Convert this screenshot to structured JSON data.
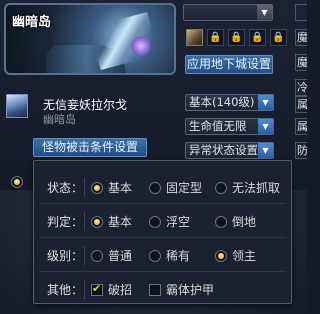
{
  "dungeon": {
    "title": "幽暗岛"
  },
  "top_dropdown": {
    "value": ""
  },
  "slots": {
    "lock_glyph": "🔒"
  },
  "apply_button": {
    "label": "应用地下城设置"
  },
  "boss": {
    "name": "无信妾妖拉尔戈",
    "location": "幽暗岛"
  },
  "selects": {
    "level": "基本(140级)",
    "hp": "生命值无限",
    "status": "异常状态设置"
  },
  "hit_condition_button": {
    "label": "怪物被击条件设置"
  },
  "right_edge_chars": [
    "魔",
    "魔",
    "冷",
    "属",
    "属",
    "防"
  ],
  "left_radio_partial": "",
  "panel": {
    "rows": [
      {
        "label": "状态：",
        "options": [
          {
            "text": "基本",
            "checked": true
          },
          {
            "text": "固定型",
            "checked": false
          },
          {
            "text": "无法抓取",
            "checked": false
          }
        ]
      },
      {
        "label": "判定：",
        "options": [
          {
            "text": "基本",
            "checked": true
          },
          {
            "text": "浮空",
            "checked": false
          },
          {
            "text": "倒地",
            "checked": false
          }
        ]
      },
      {
        "label": "级别：",
        "options": [
          {
            "text": "普通",
            "checked": false
          },
          {
            "text": "稀有",
            "checked": false
          },
          {
            "text": "领主",
            "checked": true
          }
        ]
      },
      {
        "label": "其他：",
        "options": [
          {
            "text": "破招",
            "checked": true
          },
          {
            "text": "霸体护甲",
            "checked": false
          }
        ]
      }
    ]
  },
  "colors": {
    "accent_blue": "#2f63a3",
    "radio_on": "#f0a41c",
    "panel_bg": "#1b2130"
  }
}
